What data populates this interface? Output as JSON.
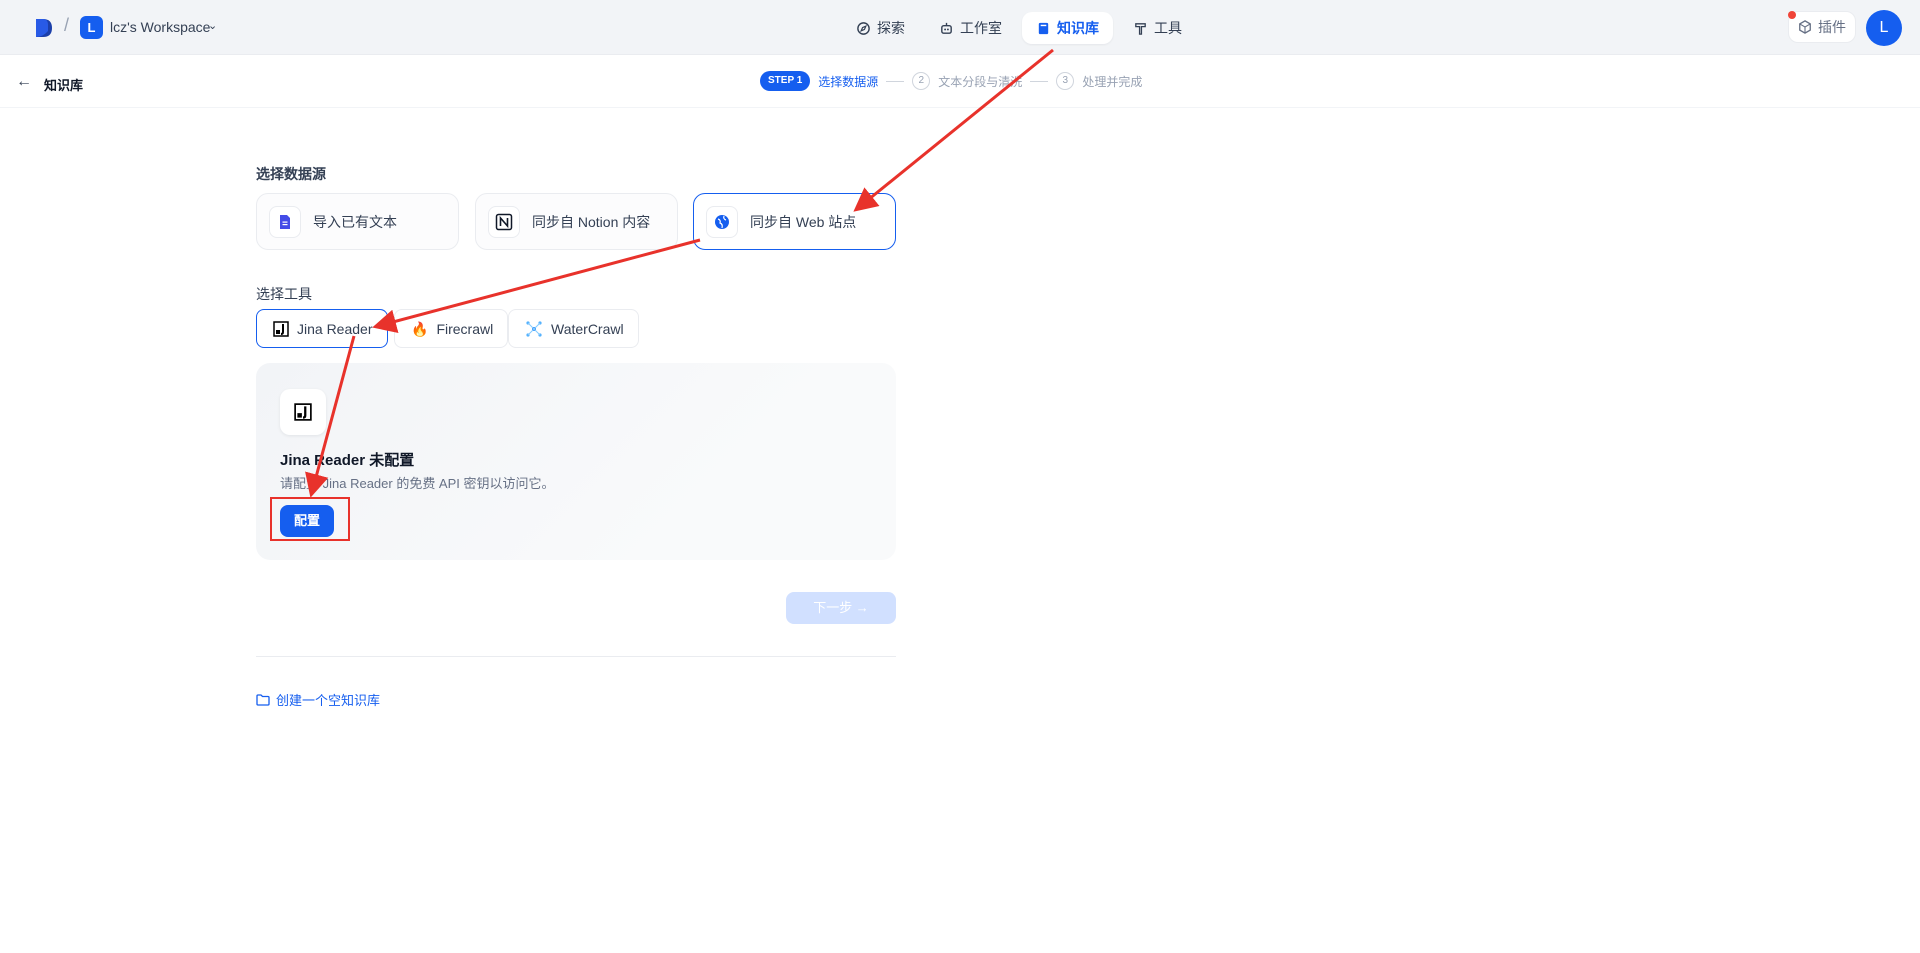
{
  "topbar": {
    "workspace_initial": "L",
    "workspace_name": "lcz's Workspace",
    "nav": [
      "探索",
      "工作室",
      "知识库",
      "工具"
    ],
    "plugin_label": "插件",
    "user_initial": "L"
  },
  "subheader": {
    "back_label": "知识库",
    "step1_badge": "STEP 1",
    "step1_label": "选择数据源",
    "step2_num": "2",
    "step2_label": "文本分段与清洗",
    "step3_num": "3",
    "step3_label": "处理并完成"
  },
  "datasource": {
    "title": "选择数据源",
    "options": [
      "导入已有文本",
      "同步自 Notion 内容",
      "同步自 Web 站点"
    ]
  },
  "tools": {
    "title": "选择工具",
    "options": [
      "Jina Reader",
      "Firecrawl",
      "WaterCrawl"
    ]
  },
  "panel": {
    "title": "Jina Reader 未配置",
    "description": "请配置 Jina Reader 的免费 API 密钥以访问它。",
    "button": "配置"
  },
  "next_button": "下一步 →",
  "create_empty": "创建一个空知识库",
  "colors": {
    "accent": "#155eef",
    "annotation": "#e8322b"
  }
}
